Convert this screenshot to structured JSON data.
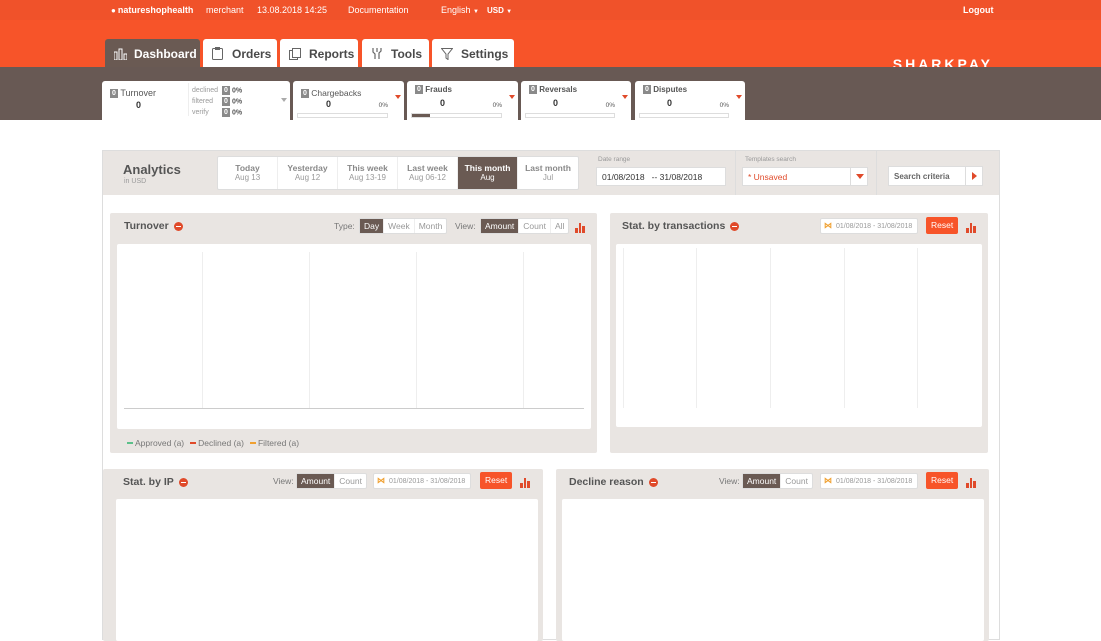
{
  "topbar": {
    "user": "natureshophealth",
    "role": "merchant",
    "datetime": "13.08.2018 14:25",
    "documentation": "Documentation",
    "language": "English",
    "currency": "USD",
    "logout": "Logout"
  },
  "nav": {
    "tabs": [
      {
        "label": "Dashboard",
        "icon": "bar-chart-icon",
        "active": true
      },
      {
        "label": "Orders",
        "icon": "clipboard-icon",
        "active": false
      },
      {
        "label": "Reports",
        "icon": "copy-icon",
        "active": false
      },
      {
        "label": "Tools",
        "icon": "tools-icon",
        "active": false
      },
      {
        "label": "Settings",
        "icon": "filter-icon",
        "active": false
      }
    ],
    "logo": "SHARKPAY"
  },
  "summary": {
    "turnover": {
      "badge": "0",
      "label": "Turnover",
      "value": "0",
      "declined_label": "declined",
      "declined_badge": "0",
      "declined_pct": "0%",
      "filtered_label": "filtered",
      "filtered_badge": "0",
      "filtered_pct": "0%",
      "verify_label": "verify",
      "verify_badge": "0",
      "verify_pct": "0%"
    },
    "chargebacks": {
      "badge": "0",
      "label": "Chargebacks",
      "value": "0",
      "pct": "0%",
      "fill": 0
    },
    "frauds": {
      "badge": "0",
      "label": "Frauds",
      "value": "0",
      "pct": "0%",
      "fill": 0.2
    },
    "reversals": {
      "badge": "0",
      "label": "Reversals",
      "value": "0",
      "pct": "0%",
      "fill": 0
    },
    "disputes": {
      "badge": "0",
      "label": "Disputes",
      "value": "0",
      "pct": "0%",
      "fill": 0
    }
  },
  "analytics": {
    "title": "Analytics",
    "subtitle": "in USD",
    "periods": [
      {
        "title": "Today",
        "sub": "Aug 13",
        "active": false
      },
      {
        "title": "Yesterday",
        "sub": "Aug 12",
        "active": false
      },
      {
        "title": "This week",
        "sub": "Aug 13-19",
        "active": false
      },
      {
        "title": "Last week",
        "sub": "Aug 06-12",
        "active": false
      },
      {
        "title": "This month",
        "sub": "Aug",
        "active": true
      },
      {
        "title": "Last month",
        "sub": "Jul",
        "active": false
      }
    ],
    "date_range_label": "Date range",
    "date_from": "01/08/2018",
    "date_to": "-- 31/08/2018",
    "templates_label": "Templates search",
    "templates_value": "* Unsaved",
    "search_criteria": "Search criteria"
  },
  "turnover_panel": {
    "title": "Turnover",
    "type_label": "Type:",
    "types": [
      "Day",
      "Week",
      "Month"
    ],
    "view_label": "View:",
    "views": [
      "Amount",
      "Count",
      "All"
    ],
    "legend": [
      {
        "label": "Approved (a)",
        "color": "#5cc08a"
      },
      {
        "label": "Declined (a)",
        "color": "#e04a2a"
      },
      {
        "label": "Filtered (a)",
        "color": "#f0a030"
      }
    ]
  },
  "transactions_panel": {
    "title": "Stat. by transactions",
    "date": "01/08/2018 - 31/08/2018",
    "reset": "Reset"
  },
  "ip_panel": {
    "title": "Stat. by IP",
    "view_label": "View:",
    "views": [
      "Amount",
      "Count"
    ],
    "date": "01/08/2018 - 31/08/2018",
    "reset": "Reset"
  },
  "decline_panel": {
    "title": "Decline reason",
    "view_label": "View:",
    "views": [
      "Amount",
      "Count"
    ],
    "date": "01/08/2018 - 31/08/2018",
    "reset": "Reset"
  },
  "colors": {
    "accent": "#f75429",
    "header_dark": "#685954",
    "active_tab": "#6a5a53"
  }
}
